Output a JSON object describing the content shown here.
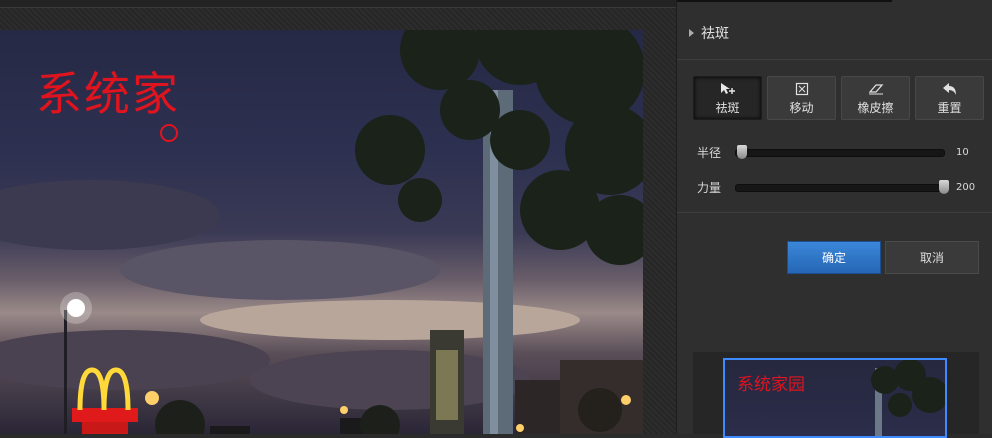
{
  "canvas": {
    "watermark_text": "系统家"
  },
  "panel": {
    "section_title": "祛斑",
    "tools": [
      {
        "label": "祛斑",
        "icon": "cursor-plus-icon",
        "active": true
      },
      {
        "label": "移动",
        "icon": "move-frame-icon",
        "active": false
      },
      {
        "label": "橡皮擦",
        "icon": "eraser-icon",
        "active": false
      },
      {
        "label": "重置",
        "icon": "undo-arrow-icon",
        "active": false
      }
    ],
    "sliders": {
      "radius": {
        "label": "半径",
        "value": "10",
        "fraction": 0.03
      },
      "strength": {
        "label": "力量",
        "value": "200",
        "fraction": 1.0
      }
    },
    "confirm_label": "确定",
    "cancel_label": "取消",
    "preview_watermark": "系统家园"
  },
  "colors": {
    "accent": "#2f78cf",
    "watermark": "#e0141e",
    "preview_border": "#3d8bff"
  }
}
